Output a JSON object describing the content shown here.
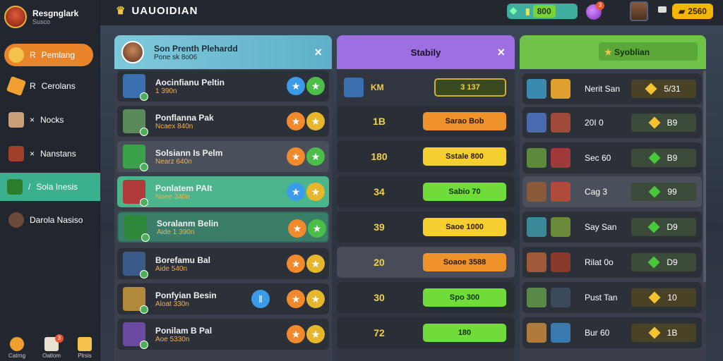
{
  "sidebar": {
    "profile_name": "Resgnglark",
    "profile_sub": "Susco",
    "items": [
      {
        "label": "Pemlang",
        "prefix": "R"
      },
      {
        "label": "Cerolans",
        "prefix": "R"
      },
      {
        "label": "Nocks",
        "prefix": "×"
      },
      {
        "label": "Nanstans",
        "prefix": "×"
      },
      {
        "label": "Sola Inesis",
        "prefix": "/"
      },
      {
        "label": "Darola Nasiso",
        "prefix": ""
      }
    ],
    "bottom_nav": [
      "Catrng",
      "Oatlom",
      "Plrsis"
    ],
    "bottom_badge": "3"
  },
  "topbar": {
    "title": "UAUOIDIAN",
    "gem_value": "800",
    "potion_badge": "3",
    "gold_value": "2560"
  },
  "left_panel": {
    "header_title": "Son Prenth Plehardd",
    "header_sub": "Pone  sk 8o06",
    "close": "×",
    "rows": [
      {
        "name": "Aocinfianu Peltin",
        "sub": "1 390n"
      },
      {
        "name": "Ponflanna Pak",
        "sub": "Ncaex 840n"
      },
      {
        "name": "Solsiann Is Pelm",
        "sub": "Nearz 640n"
      },
      {
        "name": "Ponlatem PAIt",
        "sub": "Noee 340n"
      },
      {
        "name": "Soralanm Belin",
        "sub": "Aide 1 390n"
      },
      {
        "name": "Borefamu Bal",
        "sub": "Aide 540n"
      },
      {
        "name": "Ponfyian Besin",
        "sub": "Aloat 330n"
      },
      {
        "name": "Ponilam B Pal",
        "sub": "Aoe 5330n"
      }
    ]
  },
  "mid_panel": {
    "header_title": "Stabily",
    "close": "×",
    "top_label": "KM",
    "top_btn": "3 137",
    "rows": [
      {
        "num": "1B",
        "btn": "Sarao Bob"
      },
      {
        "num": "180",
        "btn": "Sstale 800"
      },
      {
        "num": "34",
        "btn": "Sabio 70"
      },
      {
        "num": "39",
        "btn": "Saoe 1000"
      },
      {
        "num": "20",
        "btn": "Soaoe 3588"
      },
      {
        "num": "30",
        "btn": "Spo 300"
      },
      {
        "num": "72",
        "btn": "180"
      }
    ]
  },
  "right_panel": {
    "header_title": "Syoblian",
    "rows": [
      {
        "name": "Nerit San",
        "value": "5/31",
        "gem": "gold"
      },
      {
        "name": "20I 0",
        "value": "B9",
        "gem": "gold"
      },
      {
        "name": "Sec 60",
        "value": "B9",
        "gem": "green"
      },
      {
        "name": "Cag 3",
        "value": "99",
        "gem": "green"
      },
      {
        "name": "Say San",
        "value": "D9",
        "gem": "green"
      },
      {
        "name": "Rilat 0o",
        "value": "D9",
        "gem": "green"
      },
      {
        "name": "Pust Tan",
        "value": "10",
        "gem": "gold"
      },
      {
        "name": "Bur 60",
        "value": "1B",
        "gem": "gold"
      }
    ]
  }
}
